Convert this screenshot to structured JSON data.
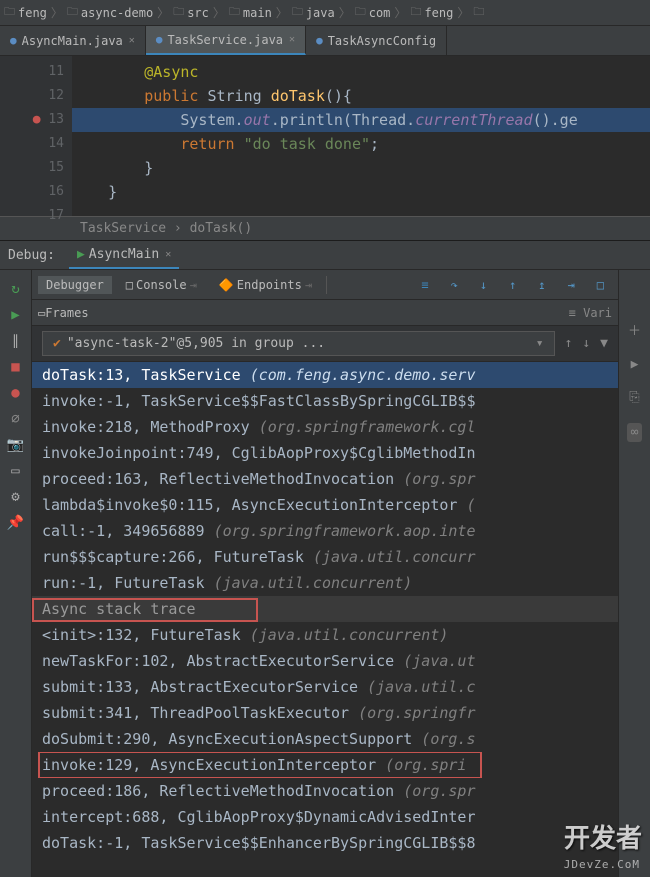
{
  "breadcrumbs": [
    "feng",
    "async-demo",
    "src",
    "main",
    "java",
    "com",
    "feng"
  ],
  "tabs": [
    {
      "name": "AsyncMain.java",
      "active": false
    },
    {
      "name": "TaskService.java",
      "active": true
    },
    {
      "name": "TaskAsyncConfig",
      "active": false
    }
  ],
  "editor": {
    "lines": [
      {
        "n": "11",
        "indent": "        ",
        "tokens": [
          {
            "t": "@Async",
            "c": "ann"
          }
        ]
      },
      {
        "n": "12",
        "indent": "        ",
        "tokens": [
          {
            "t": "public",
            "c": "kw"
          },
          {
            "t": " String ",
            "c": "cls"
          },
          {
            "t": "doTask",
            "c": "fn"
          },
          {
            "t": "(){",
            "c": "cls"
          }
        ]
      },
      {
        "n": "13",
        "bp": true,
        "exec": true,
        "indent": "            ",
        "tokens": [
          {
            "t": "System.",
            "c": "cls"
          },
          {
            "t": "out",
            "c": "fld"
          },
          {
            "t": ".println(Thread.",
            "c": "cls"
          },
          {
            "t": "currentThread",
            "c": "fld"
          },
          {
            "t": "().ge",
            "c": "cls"
          }
        ]
      },
      {
        "n": "14",
        "indent": "            ",
        "tokens": [
          {
            "t": "return ",
            "c": "kw"
          },
          {
            "t": "\"do task done\"",
            "c": "str"
          },
          {
            "t": ";",
            "c": "cls"
          }
        ]
      },
      {
        "n": "15",
        "indent": "        ",
        "tokens": [
          {
            "t": "}",
            "c": "cls"
          }
        ]
      },
      {
        "n": "16",
        "indent": "    ",
        "tokens": [
          {
            "t": "}",
            "c": "cls"
          }
        ]
      },
      {
        "n": "17",
        "indent": "",
        "tokens": [
          {
            "t": "",
            "c": "cls"
          }
        ]
      }
    ],
    "navhint": "TaskService › doTask()"
  },
  "debug": {
    "title": "Debug:",
    "run": "AsyncMain",
    "subtabs": [
      "Debugger",
      "Console",
      "Endpoints"
    ],
    "stepicons": [
      "≡",
      "↷",
      "↓",
      "↑",
      "↥",
      "⇥",
      "□"
    ],
    "frames_label": "Frames",
    "vars_label": "Vari",
    "thread": "\"async-task-2\"@5,905 in group ...",
    "frames": [
      {
        "sel": true,
        "m": "doTask:13, TaskService ",
        "p": "(com.feng.async.demo.serv"
      },
      {
        "m": "invoke:-1, TaskService$$FastClassBySpringCGLIB$$",
        "p": ""
      },
      {
        "m": "invoke:218, MethodProxy ",
        "p": "(org.springframework.cgl"
      },
      {
        "m": "invokeJoinpoint:749, CglibAopProxy$CglibMethodIn",
        "p": ""
      },
      {
        "m": "proceed:163, ReflectiveMethodInvocation ",
        "p": "(org.spr"
      },
      {
        "m": "lambda$invoke$0:115, AsyncExecutionInterceptor ",
        "p": "("
      },
      {
        "m": "call:-1, 349656889 ",
        "p": "(org.springframework.aop.inte"
      },
      {
        "m": "run$$$capture:266, FutureTask ",
        "p": "(java.util.concurr"
      },
      {
        "m": "run:-1, FutureTask ",
        "p": "(java.util.concurrent)"
      },
      {
        "hdr": true,
        "hl": 1,
        "m": "Async stack trace",
        "p": ""
      },
      {
        "m": "<init>:132, FutureTask ",
        "p": "(java.util.concurrent)"
      },
      {
        "m": "newTaskFor:102, AbstractExecutorService ",
        "p": "(java.ut"
      },
      {
        "m": "submit:133, AbstractExecutorService ",
        "p": "(java.util.c"
      },
      {
        "m": "submit:341, ThreadPoolTaskExecutor ",
        "p": "(org.springfr"
      },
      {
        "m": "doSubmit:290, AsyncExecutionAspectSupport ",
        "p": "(org.s"
      },
      {
        "hl": 2,
        "m": "invoke:129, AsyncExecutionInterceptor ",
        "p": "(org.spri"
      },
      {
        "m": "proceed:186, ReflectiveMethodInvocation ",
        "p": "(org.spr"
      },
      {
        "m": "intercept:688, CglibAopProxy$DynamicAdvisedInter",
        "p": ""
      },
      {
        "m": "doTask:-1, TaskService$$EnhancerBySpringCGLIB$$8",
        "p": ""
      }
    ]
  },
  "watermark": "开发者",
  "watermark_sub": "JDevZe.CoM"
}
